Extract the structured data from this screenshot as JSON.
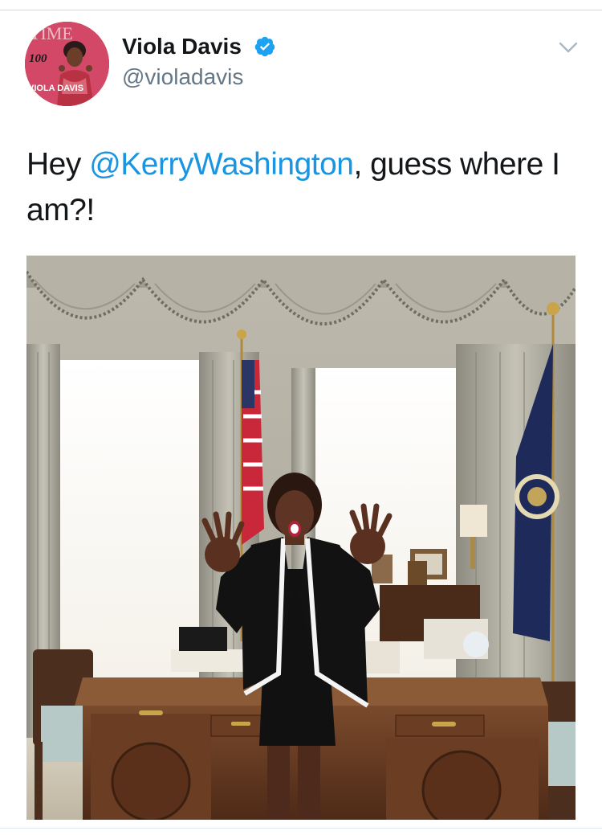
{
  "tweet": {
    "author": {
      "display_name": "Viola Davis",
      "handle": "@violadavis",
      "verified": true,
      "avatar_icon": "time-100-magazine-cover-avatar",
      "avatar_text": {
        "masthead": "TIME",
        "number": "100",
        "cover_name": "VIOLA DAVIS"
      }
    },
    "text": {
      "prefix": "Hey ",
      "mention": "@KerryWashington",
      "suffix": ", guess where I am?!"
    },
    "media": {
      "type": "photo"
    },
    "menu_icon": "chevron-down-icon"
  },
  "colors": {
    "mention": "#1b95e0",
    "handle": "#657786",
    "name": "#14171a",
    "verified": "#1da1f2"
  }
}
